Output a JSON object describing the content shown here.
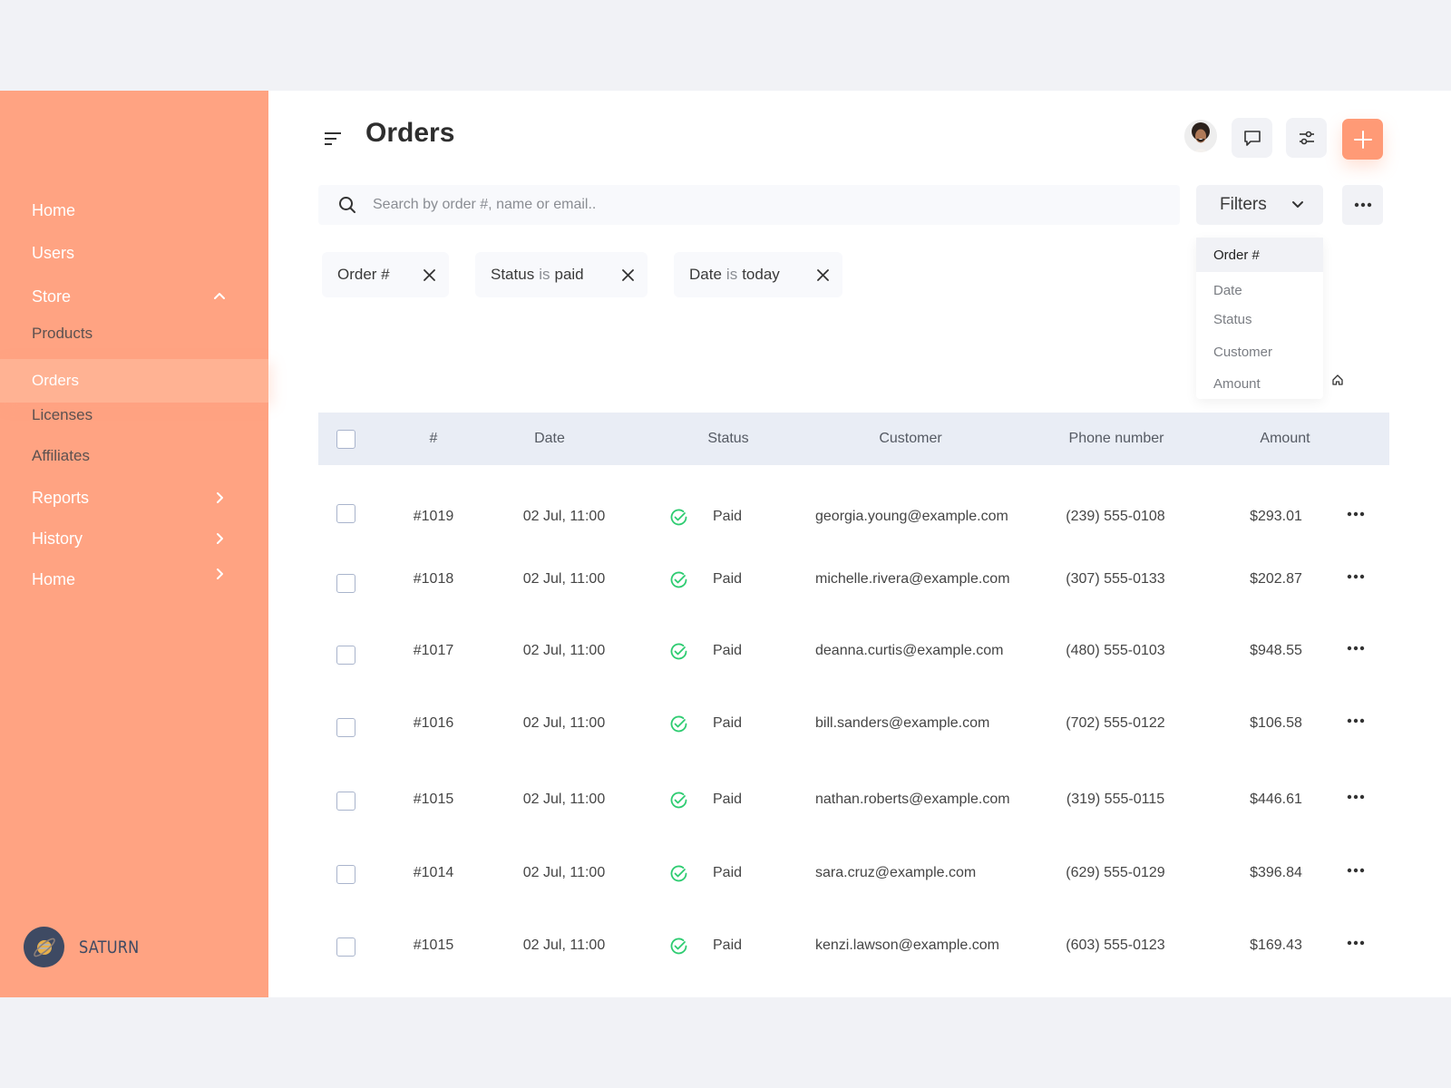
{
  "colors": {
    "sidebar": "#FFA382",
    "accent": "#FF9A76",
    "paid": "#2ECC71"
  },
  "sidebar": {
    "items": [
      {
        "label": "Home",
        "type": "top"
      },
      {
        "label": "Users",
        "type": "top"
      },
      {
        "label": "Store",
        "type": "top",
        "chevron": "chevron-up-icon"
      },
      {
        "label": "Products",
        "type": "sub"
      },
      {
        "label": "Orders",
        "type": "sub",
        "active": true
      },
      {
        "label": "Licenses",
        "type": "sub"
      },
      {
        "label": "Affiliates",
        "type": "sub"
      },
      {
        "label": "Reports",
        "type": "top",
        "chevron": "chevron-right-icon"
      },
      {
        "label": "History",
        "type": "top",
        "chevron": "chevron-right-icon"
      },
      {
        "label": "Home",
        "type": "top",
        "chevron": "chevron-right-icon"
      }
    ],
    "brand": "SATURN"
  },
  "header": {
    "title": "Orders",
    "icons": [
      "menu-icon",
      "chat-icon",
      "sliders-icon",
      "plus-icon"
    ]
  },
  "search": {
    "placeholder": "Search by order #, name or email..",
    "value": ""
  },
  "filters": {
    "label": "Filters",
    "options": [
      "Order #",
      "Date",
      "Status",
      "Customer",
      "Amount"
    ],
    "selected": "Order #"
  },
  "chips": [
    {
      "field": "Order #",
      "op": "",
      "value": ""
    },
    {
      "field": "Status",
      "op": "is",
      "value": "paid"
    },
    {
      "field": "Date",
      "op": "is",
      "value": "today"
    }
  ],
  "table": {
    "columns": [
      "#",
      "Date",
      "Status",
      "Customer",
      "Phone number",
      "Amount"
    ],
    "rows": [
      {
        "id": "#1019",
        "date": "02 Jul, 11:00",
        "status": "Paid",
        "customer": "georgia.young@example.com",
        "phone": "(239) 555-0108",
        "amount": "$293.01"
      },
      {
        "id": "#1018",
        "date": "02 Jul, 11:00",
        "status": "Paid",
        "customer": "michelle.rivera@example.com",
        "phone": "(307) 555-0133",
        "amount": "$202.87"
      },
      {
        "id": "#1017",
        "date": "02 Jul, 11:00",
        "status": "Paid",
        "customer": "deanna.curtis@example.com",
        "phone": "(480) 555-0103",
        "amount": "$948.55"
      },
      {
        "id": "#1016",
        "date": "02 Jul, 11:00",
        "status": "Paid",
        "customer": "bill.sanders@example.com",
        "phone": "(702) 555-0122",
        "amount": "$106.58"
      },
      {
        "id": "#1015",
        "date": "02 Jul, 11:00",
        "status": "Paid",
        "customer": "nathan.roberts@example.com",
        "phone": "(319) 555-0115",
        "amount": "$446.61"
      },
      {
        "id": "#1014",
        "date": "02 Jul, 11:00",
        "status": "Paid",
        "customer": "sara.cruz@example.com",
        "phone": "(629) 555-0129",
        "amount": "$396.84"
      },
      {
        "id": "#1015",
        "date": "02 Jul, 11:00",
        "status": "Paid",
        "customer": "kenzi.lawson@example.com",
        "phone": "(603) 555-0123",
        "amount": "$169.43"
      }
    ]
  }
}
